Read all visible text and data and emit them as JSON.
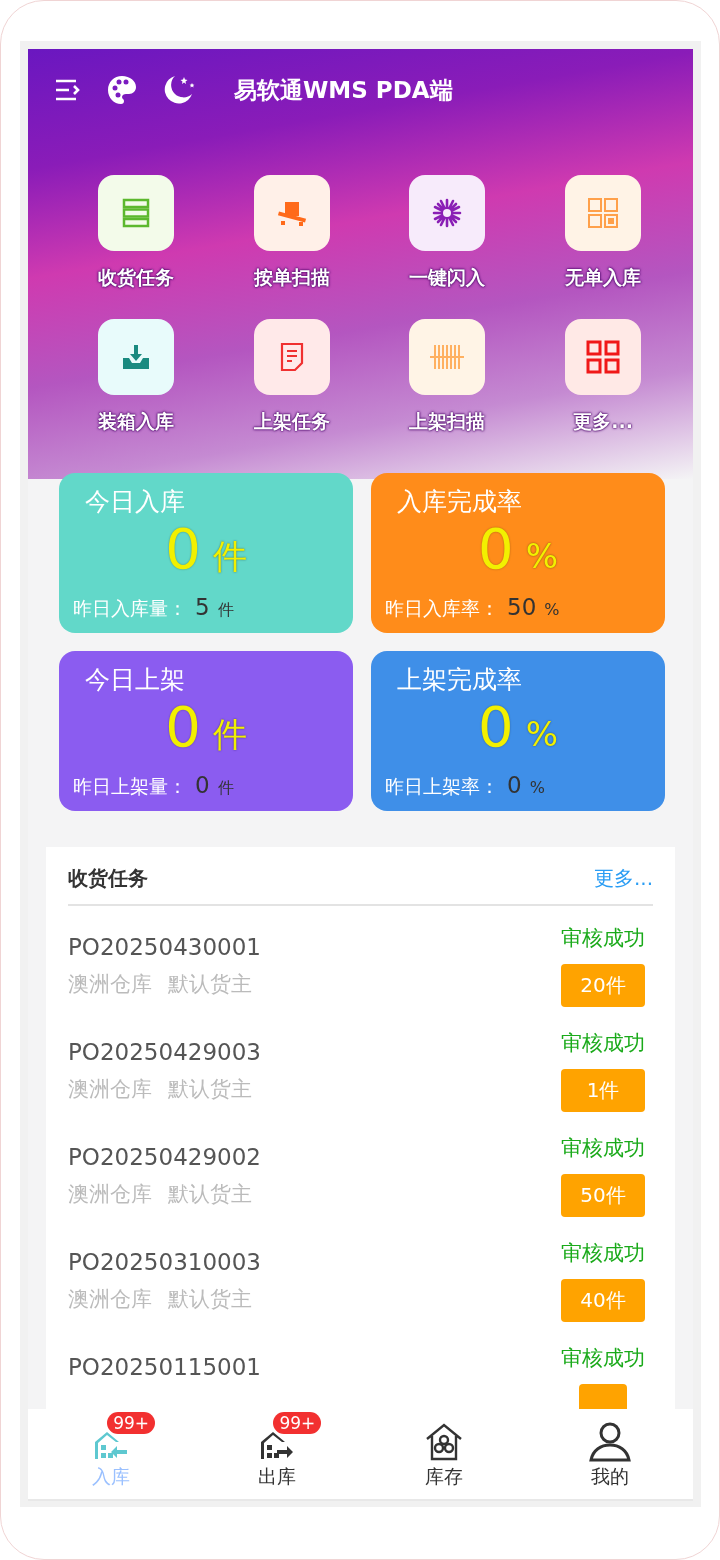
{
  "header": {
    "title": "易软通WMS PDA端"
  },
  "shortcuts": [
    {
      "label": "收货任务",
      "kind": "list"
    },
    {
      "label": "按单扫描",
      "kind": "pallet"
    },
    {
      "label": "一键闪入",
      "kind": "burst"
    },
    {
      "label": "无单入库",
      "kind": "grid-dot"
    },
    {
      "label": "装箱入库",
      "kind": "inbox"
    },
    {
      "label": "上架任务",
      "kind": "doc"
    },
    {
      "label": "上架扫描",
      "kind": "barcode"
    },
    {
      "label": "更多...",
      "kind": "grid"
    }
  ],
  "stats": [
    {
      "title": "今日入库",
      "value": "0",
      "unit": "件",
      "sub_label": "昨日入库量：",
      "sub_value": "5",
      "sub_unit": "件",
      "color": "#62d8c9"
    },
    {
      "title": "入库完成率",
      "value": "0",
      "unit": "%",
      "sub_label": "昨日入库率：",
      "sub_value": "50",
      "sub_unit": "%",
      "color": "#ff8c1a"
    },
    {
      "title": "今日上架",
      "value": "0",
      "unit": "件",
      "sub_label": "昨日上架量：",
      "sub_value": "0",
      "sub_unit": "件",
      "color": "#8b5cf0"
    },
    {
      "title": "上架完成率",
      "value": "0",
      "unit": "%",
      "sub_label": "昨日上架率：",
      "sub_value": "0",
      "sub_unit": "%",
      "color": "#3f8fe8"
    }
  ],
  "task_list": {
    "title": "收货任务",
    "more": "更多...",
    "rows": [
      {
        "order_no": "PO20250430001",
        "warehouse": "澳洲仓库",
        "owner": "默认货主",
        "status": "审核成功",
        "quantity": "20件"
      },
      {
        "order_no": "PO20250429003",
        "warehouse": "澳洲仓库",
        "owner": "默认货主",
        "status": "审核成功",
        "quantity": "1件"
      },
      {
        "order_no": "PO20250429002",
        "warehouse": "澳洲仓库",
        "owner": "默认货主",
        "status": "审核成功",
        "quantity": "50件"
      },
      {
        "order_no": "PO20250310003",
        "warehouse": "澳洲仓库",
        "owner": "默认货主",
        "status": "审核成功",
        "quantity": "40件"
      },
      {
        "order_no": "PO20250115001",
        "status": "审核成功"
      }
    ]
  },
  "tab_bar": [
    {
      "label": "入库",
      "badge": "99+",
      "kind": "inbound",
      "selected": true
    },
    {
      "label": "出库",
      "badge": "99+",
      "kind": "outbound",
      "selected": false
    },
    {
      "label": "库存",
      "kind": "stock",
      "selected": false
    },
    {
      "label": "我的",
      "kind": "user",
      "selected": false
    }
  ]
}
